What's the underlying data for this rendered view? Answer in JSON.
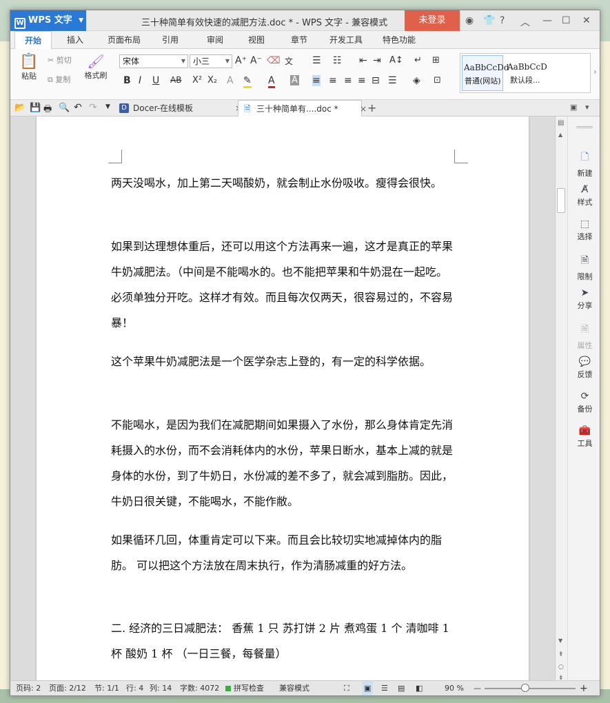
{
  "titlebar": {
    "app_button": "WPS 文字",
    "title": "三十种简单有效快速的减肥方法.doc * - WPS 文字 - 兼容模式",
    "login": "未登录"
  },
  "menu_tabs": [
    "开始",
    "插入",
    "页面布局",
    "引用",
    "审阅",
    "视图",
    "章节",
    "开发工具",
    "特色功能"
  ],
  "ribbon": {
    "paste": "粘贴",
    "cut": "剪切",
    "copy": "复制",
    "format_painter": "格式刷",
    "font_name": "宋体",
    "font_size": "小三",
    "style1_preview": "AaBbCcDd",
    "style1_name": "普通(网站)",
    "style2_preview": "AaBbCcDd",
    "style2_name": "默认段..."
  },
  "doc_tabs": [
    "Docer-在线模板",
    "三十种简单有....doc *"
  ],
  "paragraphs": [
    "两天没喝水，加上第二天喝酸奶，就会制止水份吸收。瘦得会很快。",
    "如果到达理想体重后，还可以用这个方法再来一遍，这才是真正的苹果牛奶减肥法。（中间是不能喝水的。也不能把苹果和牛奶混在一起吃。必须单独分开吃。这样才有效。而且每次仅两天，很容易过的，不容易暴！",
    "这个苹果牛奶减肥法是一个医学杂志上登的，有一定的科学依据。",
    "不能喝水，是因为我们在减肥期间如果摄入了水份，那么身体肯定先消耗摄入的水份，而不会消耗体内的水份，苹果日断水，基本上减的就是身体的水份，到了牛奶日，水份减的差不多了，就会减到脂肪。因此，牛奶日很关键，不能喝水，不能作敝。",
    "如果循环几回，体重肯定可以下来。而且会比较切实地减掉体内的脂肪。 可以把这个方法放在周末执行，作为清肠减重的好方法。",
    "二. 经济的三日减肥法： 香蕉 1 只  苏打饼 2 片  煮鸡蛋 1 个  清咖啡 1 杯  酸奶 1 杯  （一日三餐，每餐量）"
  ],
  "sidebar": [
    "新建",
    "样式",
    "选择",
    "限制",
    "分享",
    "属性",
    "反馈",
    "备份",
    "工具"
  ],
  "status": {
    "page": "页码: 2",
    "pages": "页面: 2/12",
    "section": "节: 1/1",
    "row": "行: 4",
    "col": "列: 14",
    "words": "字数: 4072",
    "spell": "拼写检查",
    "mode": "兼容模式",
    "zoom": "90 %"
  },
  "colors": {
    "accent": "#2b79d6",
    "login": "#e0604a"
  }
}
